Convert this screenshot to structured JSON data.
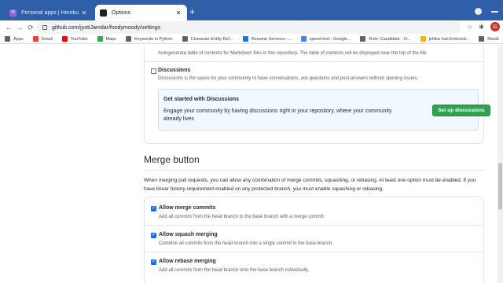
{
  "browser": {
    "tabs": [
      {
        "title": "Personal apps | Heroku",
        "active": false,
        "favicon": "heroku-icon"
      },
      {
        "title": "Options",
        "active": true,
        "favicon": "github-icon"
      }
    ],
    "new_tab": "+",
    "close_glyph": "✕",
    "url": "github.com/jyotiJamdar/foodymoody/settings",
    "avatar_letter": "G"
  },
  "bookmarks": [
    {
      "label": "Apps",
      "icon": "apps-grid-icon",
      "color": "#5f6368"
    },
    {
      "label": "Gmail",
      "icon": "gmail-icon",
      "color": "#ea4335"
    },
    {
      "label": "YouTube",
      "icon": "youtube-icon",
      "color": "#ff0000"
    },
    {
      "label": "Maps",
      "icon": "maps-icon",
      "color": "#34a853"
    },
    {
      "label": "Keywords in Python",
      "icon": "bookmark-icon",
      "color": "#5f6368"
    },
    {
      "label": "Character Entity Ref...",
      "icon": "bookmark-icon",
      "color": "#5f6368"
    },
    {
      "label": "Resume Services -...",
      "icon": "bookmark-icon",
      "color": "#1a73e8"
    },
    {
      "label": "speed test - Google...",
      "icon": "google-icon",
      "color": "#4285f4"
    },
    {
      "label": "Role: Candidate - O...",
      "icon": "bookmark-icon",
      "color": "#5f6368"
    },
    {
      "label": "juhika hub Embroid...",
      "icon": "bookmark-icon",
      "color": "#f4b400"
    },
    {
      "label": "Readi",
      "icon": "reading-list-icon",
      "color": "#5f6368"
    }
  ],
  "settings": {
    "autogen_text": "Autogenerate table of contents for Markdown files in this repository. The table of contents will be displayed near the top of the file.",
    "discussions": {
      "title": "Discussions",
      "description": "Discussions is the space for your community to have conversations, ask questions and post answers without opening issues.",
      "checked": false
    },
    "callout": {
      "title": "Get started with Discussions",
      "description": "Engage your community by having discussions right in your repository, where your community already lives",
      "button": "Set up discussions"
    },
    "merge": {
      "heading": "Merge button",
      "description": "When merging pull requests, you can allow any combination of merge commits, squashing, or rebasing. At least one option must be enabled. If you have linear history requirement enabled on any protected branch, you must enable squashing or rebasing.",
      "options": [
        {
          "label": "Allow merge commits",
          "description": "Add all commits from the head branch to the base branch with a merge commit.",
          "checked": true
        },
        {
          "label": "Allow squash merging",
          "description": "Combine all commits from the head branch into a single commit in the base branch.",
          "checked": true
        },
        {
          "label": "Allow rebase merging",
          "description": "Add all commits from the head branch onto the base branch individually.",
          "checked": true
        }
      ]
    }
  }
}
